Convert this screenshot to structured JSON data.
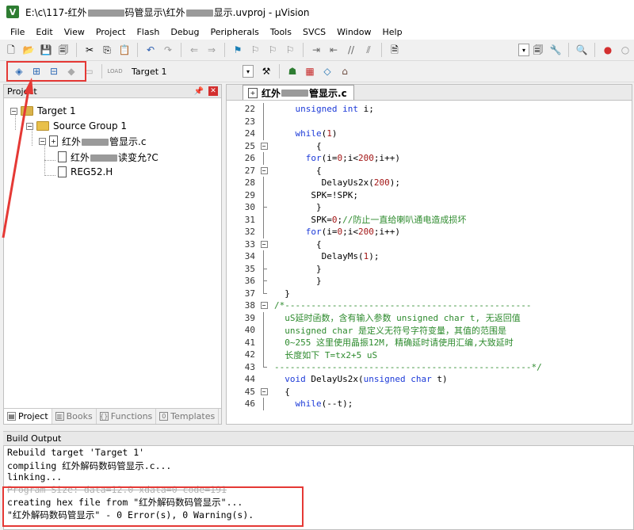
{
  "window": {
    "title_prefix": "E:\\c\\117-红外",
    "title_mid1": "码管显示\\红外",
    "title_suffix": "显示.uvproj - µVision",
    "app_icon_letter": "V"
  },
  "menu": [
    "File",
    "Edit",
    "View",
    "Project",
    "Flash",
    "Debug",
    "Peripherals",
    "Tools",
    "SVCS",
    "Window",
    "Help"
  ],
  "toolbar": {
    "target_name": "Target 1",
    "load_label": "LOAD"
  },
  "project_panel": {
    "title": "Project",
    "target": "Target 1",
    "group": "Source Group 1",
    "source_file_prefix": "红外",
    "source_file_suffix": "管显示.c",
    "child_file1_prefix": "红外",
    "child_file1_suffix": "读变允?C",
    "child_file2": "REG52.H",
    "tabs": [
      "Project",
      "Books",
      "Functions",
      "Templates"
    ]
  },
  "editor": {
    "tab_prefix": "红外",
    "tab_suffix": "管显示.c",
    "lines": [
      {
        "n": "22",
        "fold": "line",
        "html": [
          [
            "    ",
            ""
          ],
          [
            "unsigned int",
            "kw"
          ],
          [
            " i;",
            ""
          ]
        ]
      },
      {
        "n": "23",
        "fold": "line",
        "html": [
          [
            "",
            ""
          ]
        ]
      },
      {
        "n": "24",
        "fold": "line",
        "html": [
          [
            "    ",
            ""
          ],
          [
            "while",
            "kw"
          ],
          [
            "(",
            ""
          ],
          [
            "1",
            "num"
          ],
          [
            ")",
            ""
          ]
        ]
      },
      {
        "n": "25",
        "fold": "box",
        "html": [
          [
            "        {",
            ""
          ]
        ]
      },
      {
        "n": "26",
        "fold": "line",
        "html": [
          [
            "      ",
            ""
          ],
          [
            "for",
            "kw"
          ],
          [
            "(i=",
            ""
          ],
          [
            "0",
            "num"
          ],
          [
            ";i<",
            ""
          ],
          [
            "200",
            "num"
          ],
          [
            ";i++)",
            ""
          ]
        ]
      },
      {
        "n": "27",
        "fold": "box",
        "html": [
          [
            "        {",
            ""
          ]
        ]
      },
      {
        "n": "28",
        "fold": "line",
        "html": [
          [
            "         DelayUs2x(",
            ""
          ],
          [
            "200",
            "num"
          ],
          [
            ");",
            ""
          ]
        ]
      },
      {
        "n": "29",
        "fold": "line",
        "html": [
          [
            "       SPK=!SPK;",
            ""
          ]
        ]
      },
      {
        "n": "30",
        "fold": "tee",
        "html": [
          [
            "        }",
            ""
          ]
        ]
      },
      {
        "n": "31",
        "fold": "line",
        "html": [
          [
            "       SPK=",
            ""
          ],
          [
            "0",
            "num"
          ],
          [
            ";",
            ""
          ],
          [
            "//防止一直给喇叭通电造成损坏",
            "cm"
          ]
        ]
      },
      {
        "n": "32",
        "fold": "line",
        "html": [
          [
            "      ",
            ""
          ],
          [
            "for",
            "kw"
          ],
          [
            "(i=",
            ""
          ],
          [
            "0",
            "num"
          ],
          [
            ";i<",
            ""
          ],
          [
            "200",
            "num"
          ],
          [
            ";i++)",
            ""
          ]
        ]
      },
      {
        "n": "33",
        "fold": "box",
        "html": [
          [
            "        {",
            ""
          ]
        ]
      },
      {
        "n": "34",
        "fold": "line",
        "html": [
          [
            "         DelayMs(",
            ""
          ],
          [
            "1",
            "num"
          ],
          [
            ");",
            ""
          ]
        ]
      },
      {
        "n": "35",
        "fold": "tee",
        "html": [
          [
            "        }",
            ""
          ]
        ]
      },
      {
        "n": "36",
        "fold": "tee",
        "html": [
          [
            "        }",
            ""
          ]
        ]
      },
      {
        "n": "37",
        "fold": "corner",
        "html": [
          [
            "  }",
            ""
          ]
        ]
      },
      {
        "n": "38",
        "fold": "box",
        "html": [
          [
            "/*-----------------------------------------------",
            "cm"
          ]
        ]
      },
      {
        "n": "39",
        "fold": "line",
        "html": [
          [
            "  uS延时函数，含有输入参数 unsigned char t, 无返回值",
            "cm"
          ]
        ]
      },
      {
        "n": "40",
        "fold": "line",
        "html": [
          [
            "  unsigned char 是定义无符号字符变量，其值的范围是",
            "cm"
          ]
        ]
      },
      {
        "n": "41",
        "fold": "line",
        "html": [
          [
            "  0~255 这里使用晶振12M, 精确延时请使用汇编,大致延时",
            "cm"
          ]
        ]
      },
      {
        "n": "42",
        "fold": "line",
        "html": [
          [
            "  长度如下 T=tx2+5 uS",
            "cm"
          ]
        ]
      },
      {
        "n": "43",
        "fold": "corner",
        "html": [
          [
            "-------------------------------------------------*/",
            "cm"
          ]
        ]
      },
      {
        "n": "44",
        "fold": "none",
        "html": [
          [
            "  ",
            ""
          ],
          [
            "void",
            "kw"
          ],
          [
            " DelayUs2x(",
            ""
          ],
          [
            "unsigned char",
            "kw"
          ],
          [
            " t)",
            ""
          ]
        ]
      },
      {
        "n": "45",
        "fold": "box",
        "html": [
          [
            "  {",
            ""
          ]
        ]
      },
      {
        "n": "46",
        "fold": "line",
        "html": [
          [
            "    ",
            ""
          ],
          [
            "while",
            "kw"
          ],
          [
            "(--t);",
            ""
          ]
        ]
      }
    ]
  },
  "build_output": {
    "title": "Build Output",
    "lines": [
      {
        "text": "Rebuild target 'Target 1'",
        "struck": false
      },
      {
        "text": "compiling 红外解码数码管显示.c...",
        "struck": false
      },
      {
        "text": "linking...",
        "struck": false
      },
      {
        "text": "Program Size: data=12.0 xdata=0 code=191",
        "struck": true
      },
      {
        "text": "creating hex file from \"红外解码数码管显示\"...",
        "struck": false
      },
      {
        "text": "\"红外解码数码管显示\" - 0 Error(s), 0 Warning(s).",
        "struck": false
      }
    ]
  },
  "colors": {
    "highlight": "#e53935",
    "keyword": "#1c3ad8",
    "comment": "#2e8b2e",
    "number": "#a31515"
  }
}
